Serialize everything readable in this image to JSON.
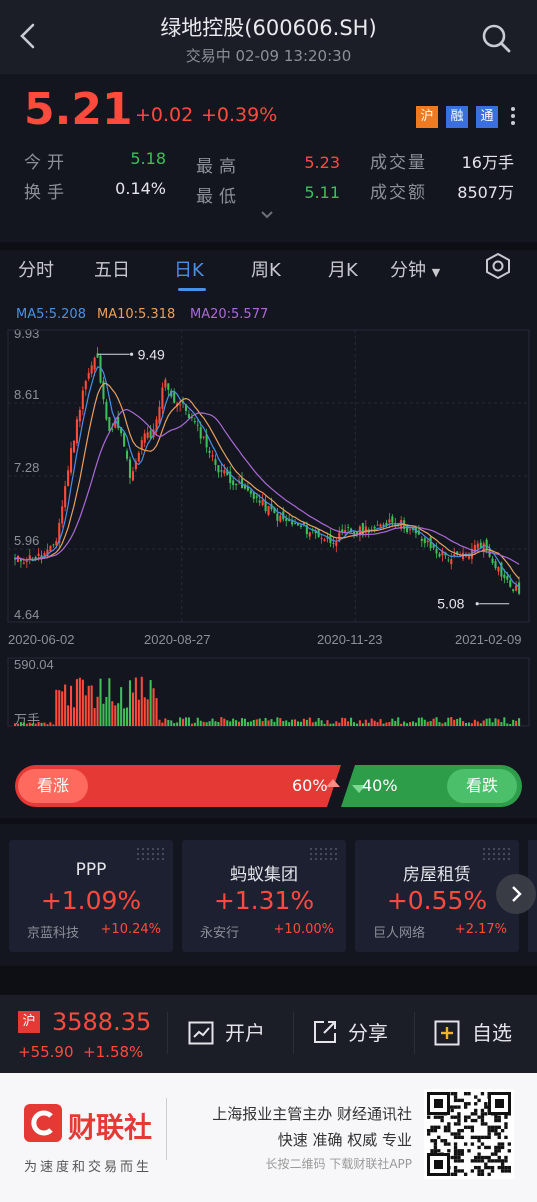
{
  "header": {
    "title": "绿地控股(600606.SH)",
    "status": "交易中 02-09 13:20:30"
  },
  "quote": {
    "price": "5.21",
    "change": "+0.02",
    "change_pct": "+0.39%",
    "badges": [
      "沪",
      "融",
      "通"
    ],
    "fields": [
      {
        "label": "今开",
        "value": "5.18"
      },
      {
        "label": "换手",
        "value": "0.14%"
      },
      {
        "label": "最高",
        "value": "5.23"
      },
      {
        "label": "最低",
        "value": "5.11"
      },
      {
        "label": "成交量",
        "value": "16万手"
      },
      {
        "label": "成交额",
        "value": "8507万"
      }
    ]
  },
  "tabs": [
    "分时",
    "五日",
    "日K",
    "周K",
    "月K",
    "分钟"
  ],
  "ma": {
    "ma5": "MA5:5.208",
    "ma10": "MA10:5.318",
    "ma20": "MA20:5.577"
  },
  "chart_data": {
    "type": "candlestick",
    "y_ticks": [
      "9.93",
      "8.61",
      "7.28",
      "5.96",
      "4.64"
    ],
    "x_ticks": [
      "2020-06-02",
      "2020-08-27",
      "2020-11-23",
      "2021-02-09"
    ],
    "ylim": [
      4.64,
      9.93
    ],
    "high_marker": "9.49",
    "low_marker": "5.08",
    "volume_max_label": "590.04",
    "volume_unit": "万手",
    "close_path": [
      5.75,
      5.78,
      5.8,
      5.8,
      5.85,
      5.9,
      6.1,
      6.8,
      7.6,
      8.2,
      8.9,
      9.2,
      9.49,
      8.6,
      8.1,
      8.3,
      7.8,
      7.2,
      7.6,
      8.1,
      7.9,
      8.4,
      9.1,
      8.7,
      8.6,
      8.5,
      8.3,
      8.1,
      7.9,
      7.6,
      7.4,
      7.3,
      7.2,
      7.1,
      7.0,
      6.95,
      6.8,
      6.7,
      6.6,
      6.5,
      6.45,
      6.4,
      6.35,
      6.3,
      6.25,
      6.2,
      6.1,
      6.15,
      6.2,
      6.3,
      6.25,
      6.3,
      6.35,
      6.3,
      6.4,
      6.5,
      6.45,
      6.4,
      6.3,
      6.2,
      6.1,
      6.0,
      5.9,
      5.85,
      5.8,
      5.8,
      5.85,
      5.9,
      6.1,
      6.0,
      5.8,
      5.6,
      5.4,
      5.25,
      5.21
    ]
  },
  "sentiment": {
    "up_label": "看涨",
    "up_pct": "60%",
    "down_pct": "40%",
    "down_label": "看跌",
    "up_color": "#e53935",
    "down_color": "#2e9d49"
  },
  "sectors": [
    {
      "name": "PPP",
      "pct": "+1.09%",
      "lead": "京蓝科技",
      "lead_pct": "+10.24%"
    },
    {
      "name": "蚂蚁集团",
      "pct": "+1.31%",
      "lead": "永安行",
      "lead_pct": "+10.00%"
    },
    {
      "name": "房屋租赁",
      "pct": "+0.55%",
      "lead": "巨人网络",
      "lead_pct": "+2.17%"
    }
  ],
  "index": {
    "badge": "沪",
    "value": "3588.35",
    "change": "+55.90",
    "change_pct": "+1.58%"
  },
  "bottom_buttons": [
    "开户",
    "分享",
    "自选"
  ],
  "footer": {
    "brand": "财联社",
    "slogan": "为速度和交易而生",
    "line1": "上海报业主管主办 财经通讯社",
    "line2": "快速 准确 权威 专业",
    "line3": "长按二维码 下载财联社APP"
  },
  "colors": {
    "up": "#ff4a3d",
    "down": "#3fbf5a",
    "accent": "#4a90e2",
    "ma5": "#4a90e2",
    "ma10": "#e8a060",
    "ma20": "#a96ad6"
  }
}
